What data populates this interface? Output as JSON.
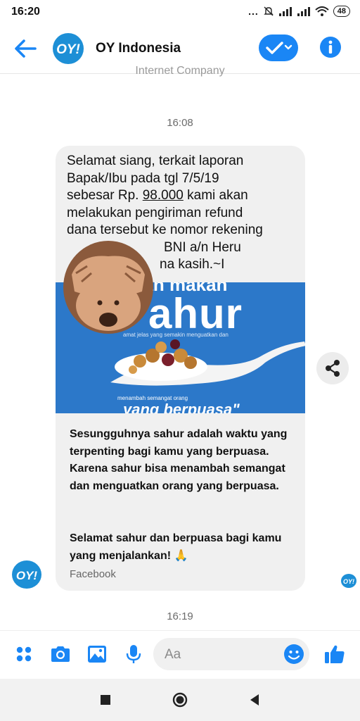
{
  "status_bar": {
    "time": "16:20",
    "dots": "...",
    "battery": "48"
  },
  "header": {
    "title": "OY Indonesia",
    "logo_text": "OY!",
    "accent_color": "#1a86f5"
  },
  "chat": {
    "faded_text": "Internet Company",
    "timestamp_top": "16:08",
    "message_lines": [
      "Selamat siang, terkait laporan",
      "Bapak/Ibu pada tgl 7/5/19",
      "sebesar Rp. ",
      "98.000",
      " kami akan",
      "melakukan pengiriman refund",
      "dana tersebut ke nomor rekening",
      "BNI a/n Heru",
      "na kasih.~I"
    ],
    "banner": {
      "top_partial": "kan makan",
      "word": "ahur",
      "small_line": "amat jelas yang semakin menguatkan dan",
      "small_line2": "menambah semangat orang",
      "bottom_partial": "yang berpuasa\""
    },
    "card_text_1": "Sesungguhnya sahur adalah waktu yang terpenting bagi kamu yang berpuasa. Karena sahur bisa menambah semangat dan menguatkan orang yang berpuasa.",
    "card_text_2": "Selamat sahur dan berpuasa bagi kamu yang menjalankan! 🙏",
    "source": "Facebook",
    "timestamp_bottom": "16:19"
  },
  "composer": {
    "placeholder": "Aa",
    "icons": [
      "apps-icon",
      "camera-icon",
      "image-icon",
      "mic-icon",
      "emoji-icon",
      "thumbs-up-icon"
    ]
  },
  "nav_bar": {
    "icons": [
      "recents-icon",
      "home-icon",
      "back-icon"
    ]
  }
}
